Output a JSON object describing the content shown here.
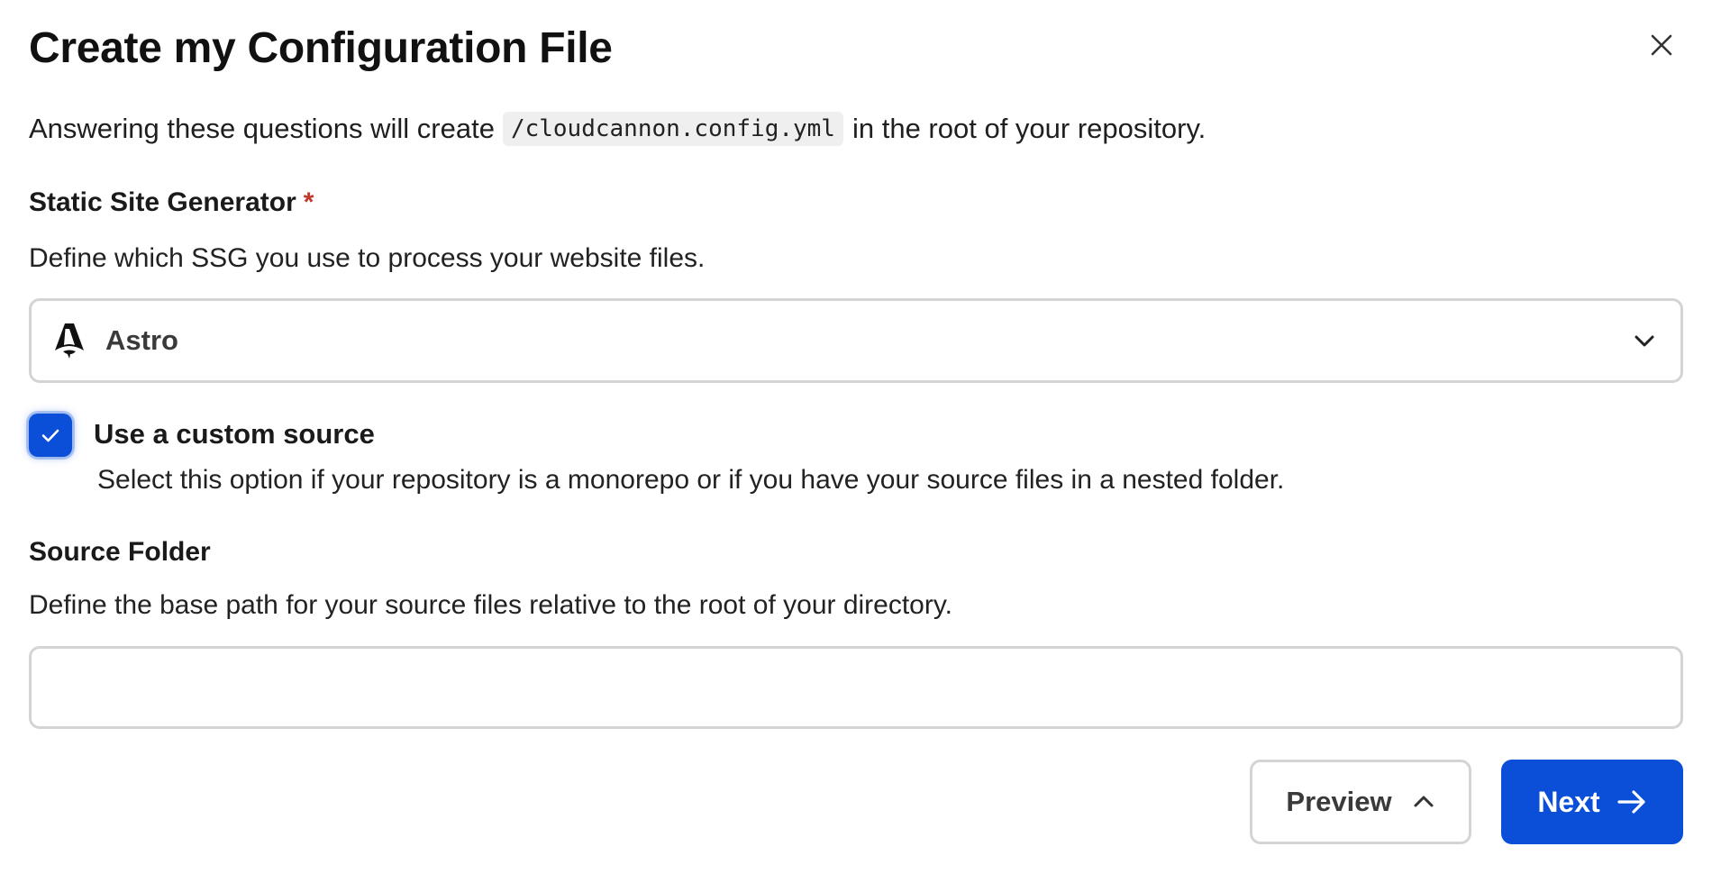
{
  "dialog": {
    "title": "Create my Configuration File",
    "close_icon": "close-icon",
    "intro": {
      "before": "Answering these questions will create",
      "code": "/cloudcannon.config.yml",
      "after": "in the root of your repository."
    }
  },
  "ssg_field": {
    "label": "Static Site Generator",
    "required_marker": "*",
    "help": "Define which SSG you use to process your website files.",
    "selected_value": "Astro",
    "selected_icon": "astro-logo-icon",
    "dropdown_icon": "chevron-down-icon"
  },
  "custom_source": {
    "checked": true,
    "label": "Use a custom source",
    "help": "Select this option if your repository is a monorepo or if you have your source files in a nested folder."
  },
  "source_folder": {
    "label": "Source Folder",
    "help": "Define the base path for your source files relative to the root of your directory.",
    "value": "",
    "placeholder": ""
  },
  "actions": {
    "preview_label": "Preview",
    "preview_icon": "chevron-up-icon",
    "next_label": "Next",
    "next_icon": "arrow-right-icon"
  },
  "colors": {
    "primary": "#0b4fd8",
    "required": "#c0392b",
    "border": "#d4d4d4"
  }
}
